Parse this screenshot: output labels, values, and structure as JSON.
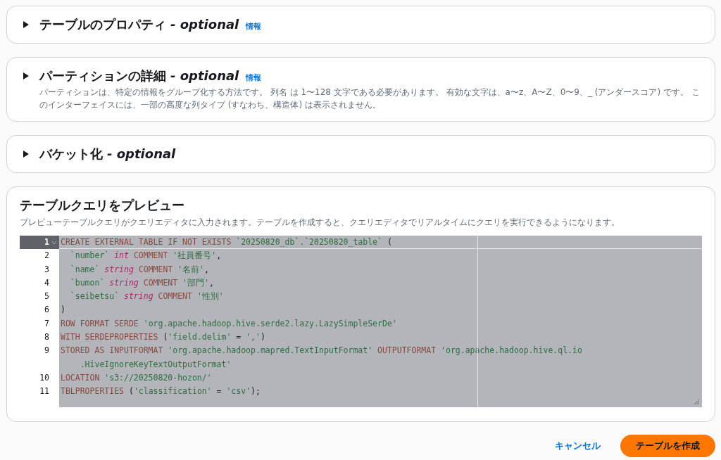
{
  "sections": [
    {
      "title": "テーブルのプロパティ",
      "optional": "- optional",
      "info": "情報",
      "expanded": false
    },
    {
      "title": "パーティションの詳細",
      "optional": "- optional",
      "info": "情報",
      "expanded": false,
      "description": "パーティションは、特定の情報をグループ化する方法です。 列名 は 1〜128 文字である必要があります。 有効な文字は、a〜z、A〜Z、0〜9、_ (アンダースコア) です。 このインターフェイスには、一部の高度な列タイプ (すなわち、構造体) は表示されません。"
    },
    {
      "title": "バケット化",
      "optional": "- optional",
      "expanded": false
    }
  ],
  "preview": {
    "title": "テーブルクエリをプレビュー",
    "description": "プレビューテーブルクエリがクエリエディタに入力されます。テーブルを作成すると、クエリエディタでリアルタイムにクエリを実行できるようになります。",
    "lines": [
      {
        "number": "1",
        "active": true,
        "tokens": [
          {
            "kind": "kw",
            "text": "CREATE EXTERNAL TABLE IF NOT EXISTS "
          },
          {
            "kind": "str",
            "text": "`20250820_db`.`20250820_table`"
          },
          {
            "kind": "plain",
            "text": " ("
          }
        ]
      },
      {
        "number": "2",
        "active": false,
        "tokens": [
          {
            "kind": "str",
            "text": "  `number` "
          },
          {
            "kind": "type",
            "text": "int"
          },
          {
            "kind": "kw",
            "text": " COMMENT "
          },
          {
            "kind": "str",
            "text": "'社員番号'"
          },
          {
            "kind": "plain",
            "text": ","
          }
        ]
      },
      {
        "number": "3",
        "active": false,
        "tokens": [
          {
            "kind": "str",
            "text": "  `name` "
          },
          {
            "kind": "type",
            "text": "string"
          },
          {
            "kind": "kw",
            "text": " COMMENT "
          },
          {
            "kind": "str",
            "text": "'名前'"
          },
          {
            "kind": "plain",
            "text": ","
          }
        ]
      },
      {
        "number": "4",
        "active": false,
        "tokens": [
          {
            "kind": "str",
            "text": "  `bumon` "
          },
          {
            "kind": "type",
            "text": "string"
          },
          {
            "kind": "kw",
            "text": " COMMENT "
          },
          {
            "kind": "str",
            "text": "'部門'"
          },
          {
            "kind": "plain",
            "text": ","
          }
        ]
      },
      {
        "number": "5",
        "active": false,
        "tokens": [
          {
            "kind": "str",
            "text": "  `seibetsu` "
          },
          {
            "kind": "type",
            "text": "string"
          },
          {
            "kind": "kw",
            "text": " COMMENT "
          },
          {
            "kind": "str",
            "text": "'性別'"
          }
        ]
      },
      {
        "number": "6",
        "active": false,
        "tokens": [
          {
            "kind": "plain",
            "text": ")"
          }
        ]
      },
      {
        "number": "7",
        "active": false,
        "tokens": [
          {
            "kind": "kw",
            "text": "ROW FORMAT SERDE "
          },
          {
            "kind": "str",
            "text": "'org.apache.hadoop.hive.serde2.lazy.LazySimpleSerDe'"
          }
        ]
      },
      {
        "number": "8",
        "active": false,
        "tokens": [
          {
            "kind": "kw",
            "text": "WITH SERDEPROPERTIES "
          },
          {
            "kind": "plain",
            "text": "("
          },
          {
            "kind": "str",
            "text": "'field.delim'"
          },
          {
            "kind": "plain",
            "text": " = "
          },
          {
            "kind": "str",
            "text": "','"
          },
          {
            "kind": "plain",
            "text": ")"
          }
        ]
      },
      {
        "number": "9",
        "active": false,
        "tokens": [
          {
            "kind": "kw",
            "text": "STORED AS INPUTFORMAT "
          },
          {
            "kind": "str",
            "text": "'org.apache.hadoop.mapred.TextInputFormat'"
          },
          {
            "kind": "kw",
            "text": " OUTPUTFORMAT "
          },
          {
            "kind": "str",
            "text": "'org.apache.hadoop.hive.ql.io"
          }
        ]
      },
      {
        "active": false,
        "tokens": [
          {
            "kind": "str",
            "text": "    .HiveIgnoreKeyTextOutputFormat'"
          }
        ]
      },
      {
        "number": "10",
        "active": false,
        "tokens": [
          {
            "kind": "kw",
            "text": "LOCATION "
          },
          {
            "kind": "str",
            "text": "'s3://20250820-hozon/'"
          }
        ]
      },
      {
        "number": "11",
        "active": false,
        "tokens": [
          {
            "kind": "kw",
            "text": "TBLPROPERTIES "
          },
          {
            "kind": "plain",
            "text": "("
          },
          {
            "kind": "str",
            "text": "'classification'"
          },
          {
            "kind": "plain",
            "text": " = "
          },
          {
            "kind": "str",
            "text": "'csv'"
          },
          {
            "kind": "plain",
            "text": ");"
          }
        ]
      }
    ]
  },
  "buttons": [
    {
      "label": "キャンセル",
      "kind": "link"
    },
    {
      "label": "テーブルを作成",
      "kind": "primary"
    }
  ]
}
